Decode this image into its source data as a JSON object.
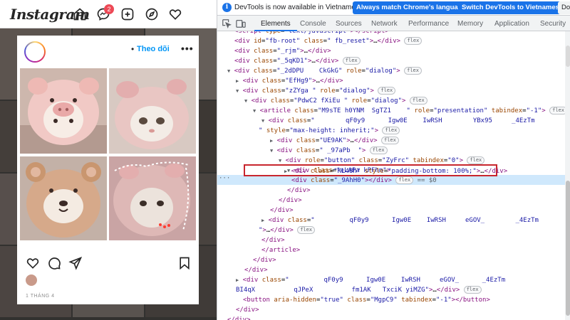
{
  "instagram": {
    "logo": "Instagram",
    "notification_count": "2",
    "post": {
      "follow_label": "Theo dõi",
      "dot": "•",
      "more": "•••",
      "date": "1 THÁNG 4"
    }
  },
  "devtools": {
    "infobar": {
      "text": "DevTools is now available in Vietnamese!",
      "btn_match": "Always match Chrome's language",
      "btn_switch": "Switch DevTools to Vietnamese",
      "btn_dont": "Don"
    },
    "tabs": [
      "Elements",
      "Console",
      "Sources",
      "Network",
      "Performance",
      "Memory",
      "Application",
      "Security"
    ],
    "active_tab": "Elements",
    "selected_marker": "== $0",
    "gutter_dots": "···"
  },
  "colors": {
    "accent": "#1a73e8",
    "highlight_box": "#c8262e",
    "follow": "#0095f6",
    "tag": "#881280",
    "attr": "#994500",
    "value": "#1a1aa6"
  }
}
